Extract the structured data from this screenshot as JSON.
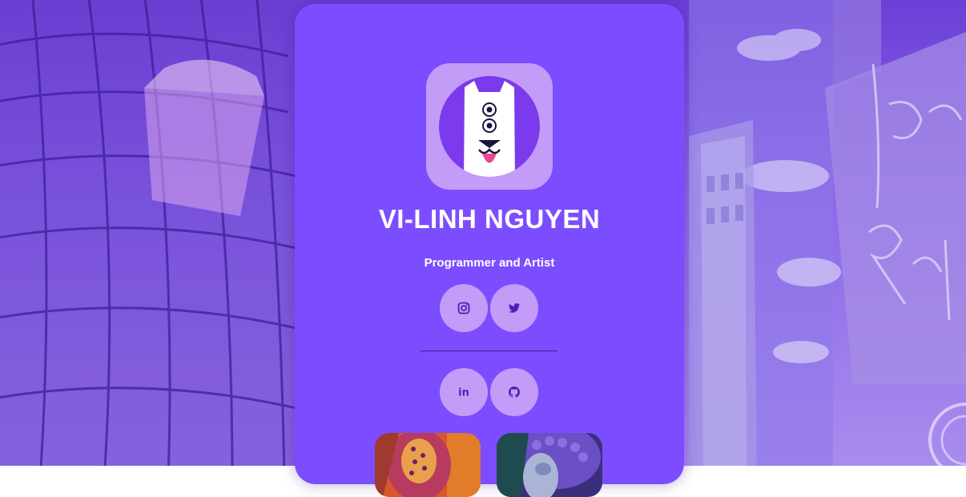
{
  "profile": {
    "name": "VI-LINH NGUYEN",
    "tagline": "Programmer and Artist",
    "avatar_icon": "dog-mascot-icon"
  },
  "social_links": [
    {
      "name": "instagram",
      "icon": "instagram-icon"
    },
    {
      "name": "twitter",
      "icon": "twitter-icon"
    },
    {
      "name": "linkedin",
      "icon": "linkedin-icon",
      "label": "in"
    },
    {
      "name": "github",
      "icon": "github-icon"
    }
  ],
  "gallery": [
    {
      "name": "artwork-1",
      "icon": "artwork-thumbnail"
    },
    {
      "name": "artwork-2",
      "icon": "artwork-thumbnail"
    }
  ],
  "colors": {
    "card": "#7c4dff",
    "button": "#c39cf7",
    "icon": "#4a22b5",
    "text": "#ffffff"
  }
}
